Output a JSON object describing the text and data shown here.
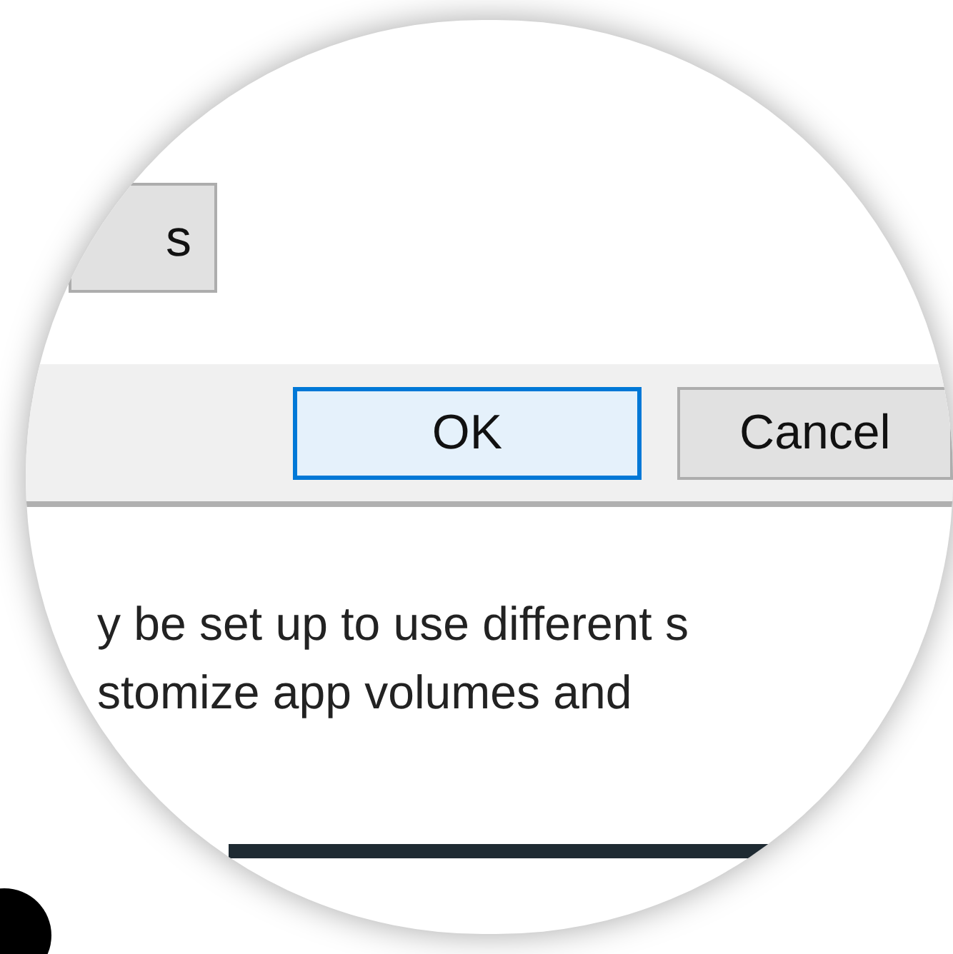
{
  "partial_button": {
    "label": "s"
  },
  "buttons": [
    {
      "label": "OK",
      "selected": true
    },
    {
      "label": "Cancel",
      "selected": false
    }
  ],
  "description_lines": [
    "y be set up to use different s",
    "stomize app volumes and"
  ]
}
